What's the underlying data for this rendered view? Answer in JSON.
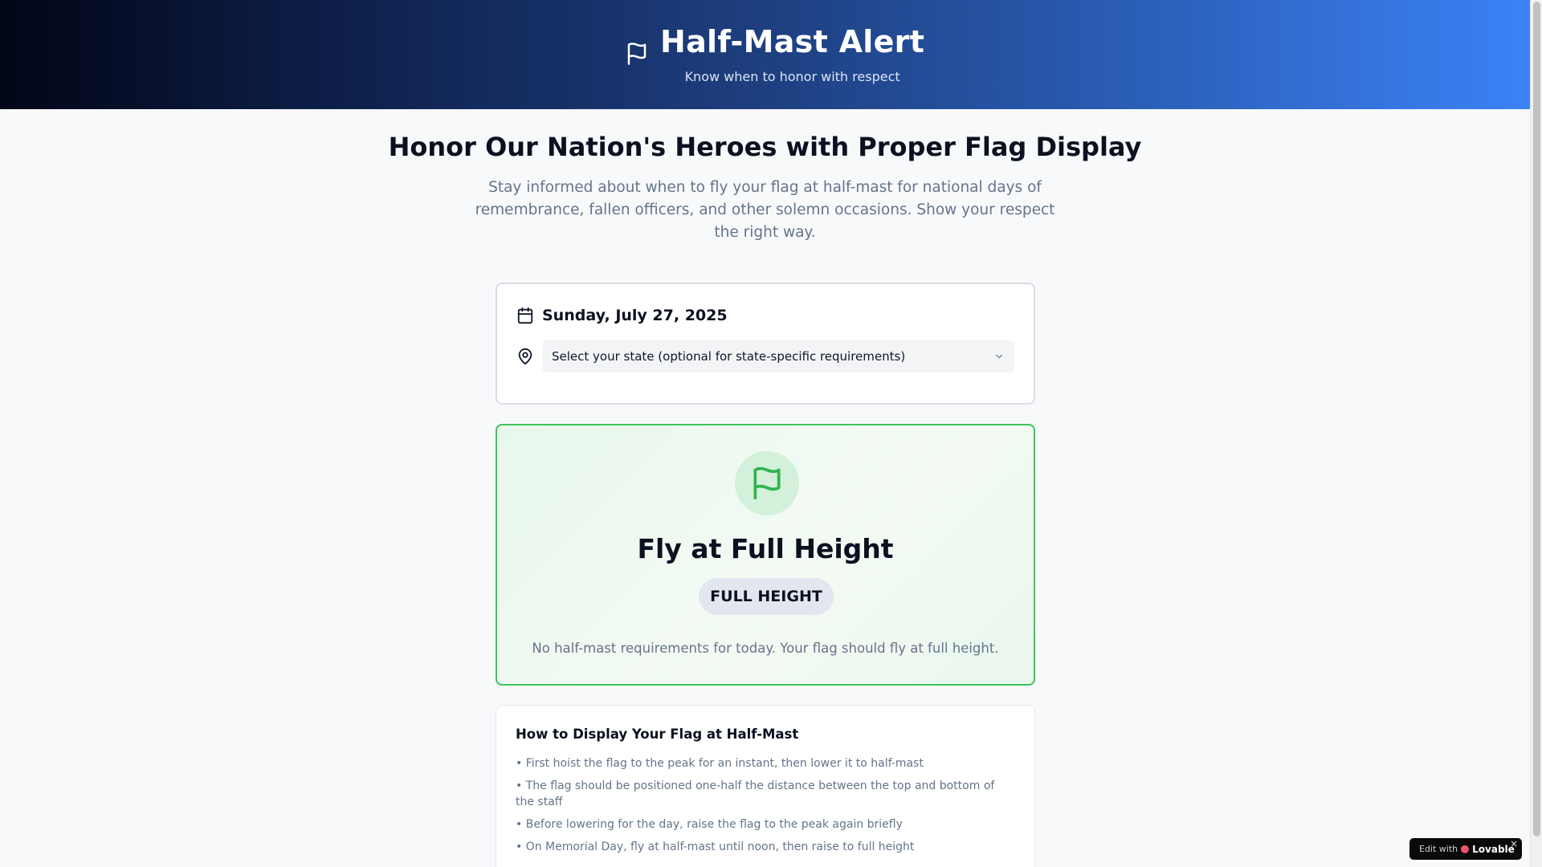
{
  "header": {
    "title": "Half-Mast Alert",
    "subtitle": "Know when to honor with respect",
    "icon": "flag-icon"
  },
  "hero": {
    "title": "Honor Our Nation's Heroes with Proper Flag Display",
    "text": "Stay informed about when to fly your flag at half-mast for national days of remembrance, fallen officers, and other solemn occasions. Show your respect the right way."
  },
  "date_card": {
    "date": "Sunday, July 27, 2025",
    "date_icon": "calendar-icon",
    "state_icon": "map-pin-icon",
    "state_select_value": "Select your state (optional for state-specific requirements)"
  },
  "status": {
    "title": "Fly at Full Height",
    "badge": "FULL HEIGHT",
    "message": "No half-mast requirements for today. Your flag should fly at full height.",
    "accent_color": "#3ec45a"
  },
  "guide": {
    "title": "How to Display Your Flag at Half-Mast",
    "items": [
      "• First hoist the flag to the peak for an instant, then lower it to half-mast",
      "• The flag should be positioned one-half the distance between the top and bottom of the staff",
      "• Before lowering for the day, raise the flag to the peak again briefly",
      "• On Memorial Day, fly at half-mast until noon, then raise to full height"
    ]
  },
  "badge": {
    "prefix": "Edit with",
    "brand": "Lovable",
    "close": "×"
  }
}
